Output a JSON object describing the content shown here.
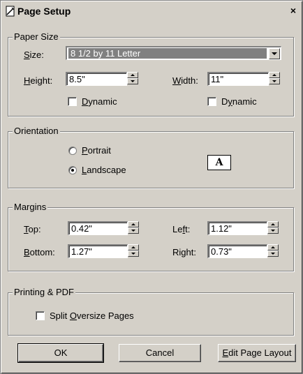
{
  "window": {
    "title": "Page Setup",
    "close_glyph": "×"
  },
  "paper_size": {
    "legend": "Paper Size",
    "size_label": "Size:",
    "size_value": "8 1/2 by 11 Letter",
    "height_label": "Height:",
    "height_value": "8.5\"",
    "width_label": "Width:",
    "width_value": "11\"",
    "dynamic_label": "Dynamic"
  },
  "orientation": {
    "legend": "Orientation",
    "portrait_label": "Portrait",
    "landscape_label": "Landscape",
    "selected": "Landscape",
    "paper_icon_glyph": "A"
  },
  "margins": {
    "legend": "Margins",
    "top_label": "Top:",
    "top_value": "0.42\"",
    "left_label": "Left:",
    "left_value": "1.12\"",
    "bottom_label": "Bottom:",
    "bottom_value": "1.27\"",
    "right_label": "Right:",
    "right_value": "0.73\""
  },
  "printing": {
    "legend": "Printing & PDF",
    "split_label": "Split Oversize Pages"
  },
  "buttons": {
    "ok": "OK",
    "cancel": "Cancel",
    "edit_layout": "Edit Page Layout"
  },
  "colors": {
    "face": "#d4d0c8",
    "shadow": "#808080",
    "highlight": "#ffffff",
    "selection": "#808080"
  }
}
